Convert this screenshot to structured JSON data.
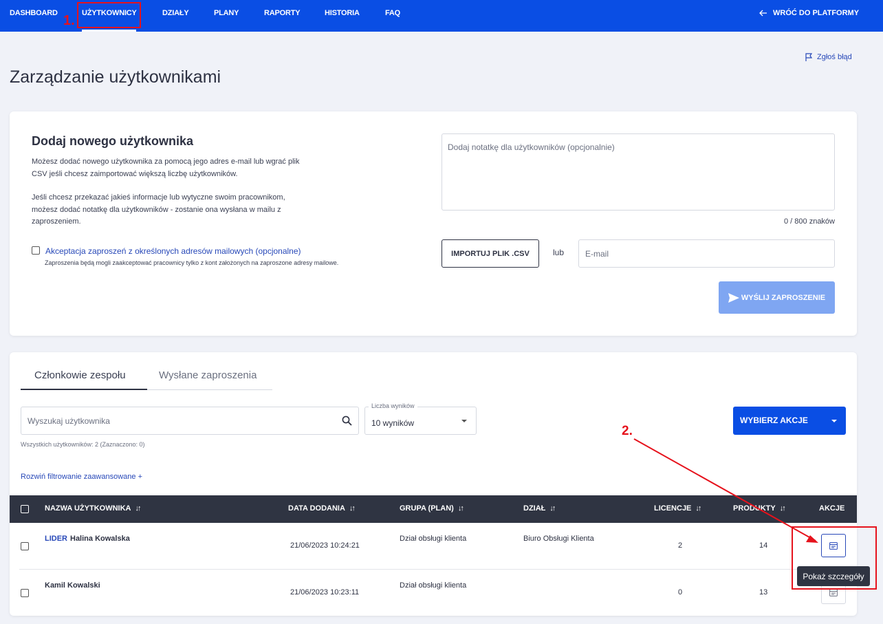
{
  "nav": {
    "items": [
      "DASHBOARD",
      "UŻYTKOWNICY",
      "DZIAŁY",
      "PLANY",
      "RAPORTY",
      "HISTORIA",
      "FAQ"
    ],
    "back_label": "WRÓĆ DO PLATFORMY"
  },
  "report_label": "Zgłoś błąd",
  "page_title": "Zarządzanie użytkownikami",
  "add_user": {
    "title": "Dodaj nowego użytkownika",
    "desc1": "Możesz dodać nowego użytkownika za pomocą jego adres e-mail lub wgrać plik CSV jeśli chcesz zaimportować większą liczbę użytkowników.",
    "desc2": "Jeśli chcesz przekazać jakieś informacje lub wytyczne swoim pracownikom, możesz dodać notatkę dla użytkowników - zostanie ona wysłana w mailu z zaproszeniem.",
    "accept_label": "Akceptacja zaproszeń z określonych adresów mailowych (opcjonalne)",
    "accept_checked": false,
    "accept_hint": "Zaproszenia będą mogli zaakceptować pracownicy tylko z kont założonych na zaproszone adresy mailowe.",
    "note_placeholder": "Dodaj notatkę dla użytkowników (opcjonalnie)",
    "note_counter": "0 / 800 znaków",
    "import_label": "IMPORTUJ PLIK .CSV",
    "or_label": "lub",
    "email_placeholder": "E-mail",
    "send_label": "WYŚLIJ ZAPROSZENIE"
  },
  "list": {
    "tabs": [
      "Członkowie zespołu",
      "Wysłane zaproszenia"
    ],
    "active_tab": "Członkowie zespołu",
    "search_placeholder": "Wyszukaj użytkownika",
    "results_label": "Liczba wyników",
    "results_value": "10 wyników",
    "actions_label": "WYBIERZ AKCJE",
    "total_text": "Wszystkich użytkowników: 2 (Zaznaczono: 0)",
    "advanced_filter": "Rozwiń filtrowanie zaawansowane +",
    "columns": [
      "NAZWA UŻYTKOWNIKA",
      "DATA DODANIA",
      "GRUPA (PLAN)",
      "DZIAŁ",
      "LICENCJE",
      "PRODUKTY",
      "AKCJE"
    ],
    "rows": [
      {
        "badge": "LIDER",
        "name": "Halina Kowalska",
        "date": "21/06/2023 10:24:21",
        "group": "Dział obsługi klienta",
        "department": "Biuro Obsługi Klienta",
        "licenses": "2",
        "products": "14"
      },
      {
        "badge": "",
        "name": "Kamil Kowalski",
        "date": "21/06/2023 10:23:11",
        "group": "Dział obsługi klienta",
        "department": "",
        "licenses": "0",
        "products": "13"
      }
    ],
    "tooltip": "Pokaż szczegóły"
  },
  "annotations": {
    "step1": "1.",
    "step2": "2."
  },
  "colors": {
    "brand": "#0a4ee4",
    "header_dark": "#2f3442",
    "link": "#2748b8",
    "send_disabled": "#7fa6f2",
    "annotation": "#e6121c"
  }
}
